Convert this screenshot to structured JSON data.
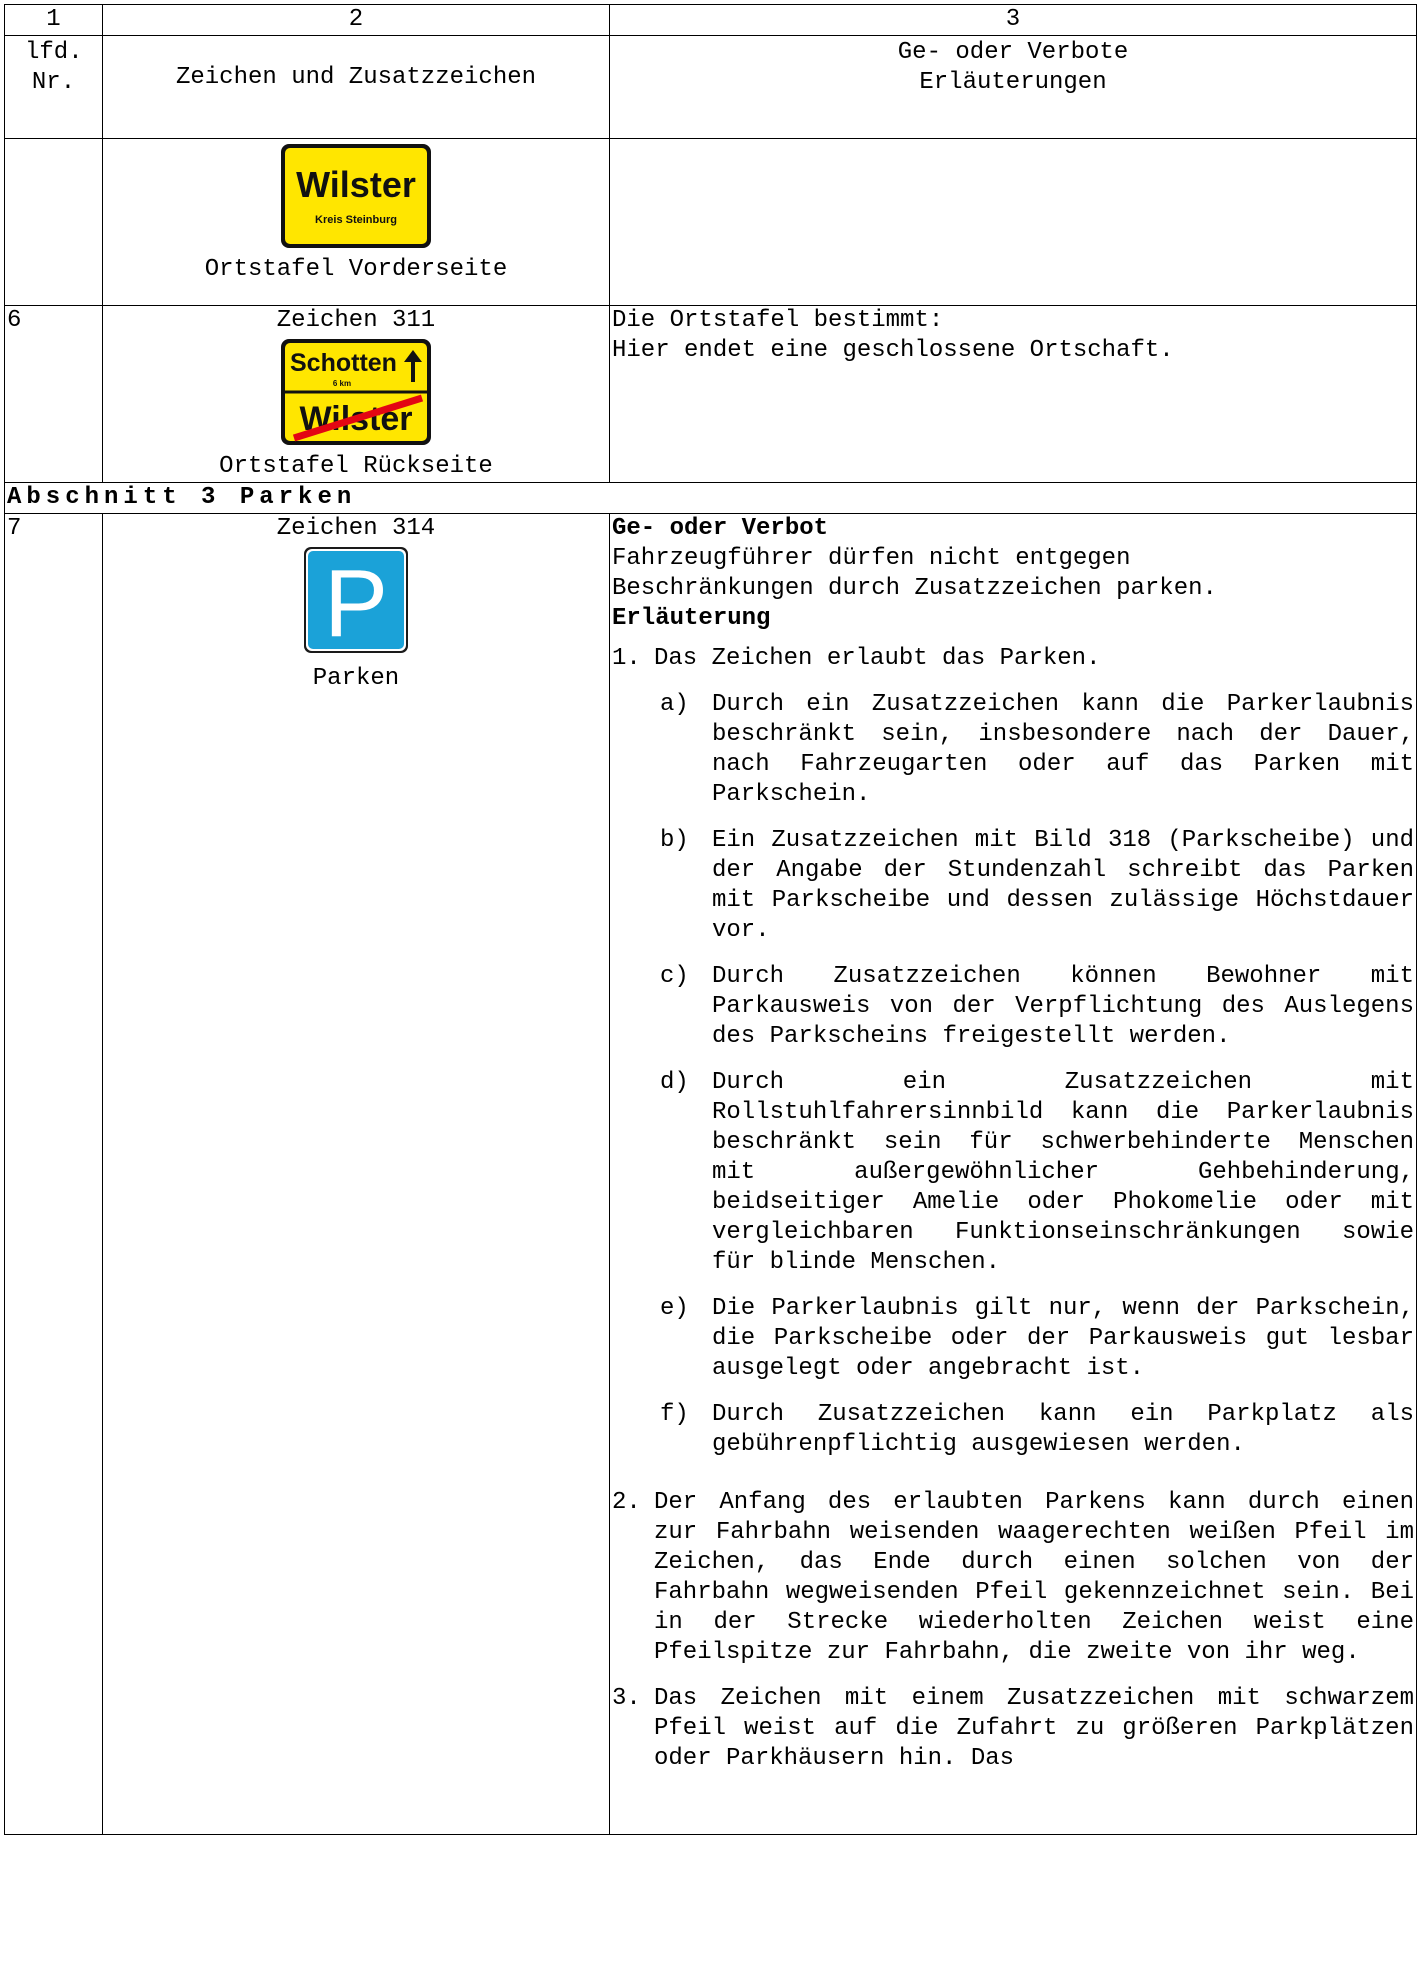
{
  "column_numbers": [
    "1",
    "2",
    "3"
  ],
  "header": {
    "col1": "lfd. Nr.",
    "col2": "Zeichen und Zusatzzeichen",
    "col3_line1": "Ge- oder Verbote",
    "col3_line2": "Erläuterungen"
  },
  "row_front": {
    "sign_text_main": "Wilster",
    "sign_text_sub": "Kreis Steinburg",
    "caption": "Ortstafel Vorderseite"
  },
  "row6": {
    "nr": "6",
    "sign_label": "Zeichen 311",
    "sign_top_text": "Schotten",
    "sign_top_dist": "6 km",
    "sign_bottom_text": "Wilster",
    "caption": "Ortstafel Rückseite",
    "text_line1": "Die Ortstafel bestimmt:",
    "text_line2": "Hier endet eine geschlossene Ortschaft."
  },
  "section": "Abschnitt 3   Parken",
  "row7": {
    "nr": "7",
    "sign_label": "Zeichen 314",
    "sign_letter": "P",
    "caption": "Parken",
    "heading1": "Ge- oder Verbot",
    "rule": "Fahrzeugführer dürfen nicht entgegen Beschränkungen durch Zusatzzeichen parken.",
    "heading2": "Erläuterung",
    "item1_num": "1.",
    "item1": "Das Zeichen erlaubt das Parken.",
    "subs": [
      {
        "label": "a)",
        "text": "Durch ein Zusatzzeichen kann die Parkerlaubnis beschränkt sein, insbesondere nach der Dauer, nach Fahrzeugarten oder auf das Parken mit Parkschein."
      },
      {
        "label": "b)",
        "text": "Ein Zusatzzeichen mit Bild 318 (Parkscheibe) und der Angabe der Stundenzahl schreibt das Parken mit Parkscheibe und dessen zulässige Höchstdauer vor."
      },
      {
        "label": "c)",
        "text": "Durch Zusatzzeichen können Bewohner mit Parkausweis von der Verpflichtung des Auslegens des Parkscheins freigestellt werden."
      },
      {
        "label": "d)",
        "text": "Durch ein Zusatzzeichen mit Rollstuhlfahrersinnbild kann die Parkerlaubnis beschränkt sein für schwerbehinderte Menschen mit außergewöhnlicher Gehbehinderung, beidseitiger Amelie oder Phokomelie oder mit vergleichbaren Funktionseinschränkungen sowie für blinde Menschen."
      },
      {
        "label": "e)",
        "text": "Die Parkerlaubnis gilt nur, wenn der Parkschein, die Parkscheibe oder der Parkausweis gut lesbar ausgelegt oder angebracht ist."
      },
      {
        "label": "f)",
        "text": "Durch Zusatzzeichen kann ein Parkplatz als gebührenpflichtig ausgewiesen werden."
      }
    ],
    "item2_num": "2.",
    "item2": "Der Anfang des erlaubten Parkens kann durch einen zur Fahrbahn weisenden waagerechten weißen Pfeil im Zeichen, das Ende durch einen solchen von der Fahrbahn wegweisenden Pfeil gekennzeichnet sein. Bei in der Strecke wiederholten Zeichen weist eine Pfeilspitze zur Fahrbahn, die zweite von ihr weg.",
    "item3_num": "3.",
    "item3": "Das Zeichen mit einem Zusatzzeichen mit schwarzem Pfeil weist auf die Zufahrt zu größeren Parkplätzen oder Parkhäusern hin. Das"
  },
  "colors": {
    "sign_yellow": "#ffe600",
    "sign_red": "#e30613",
    "sign_blue": "#1ba2d8"
  }
}
